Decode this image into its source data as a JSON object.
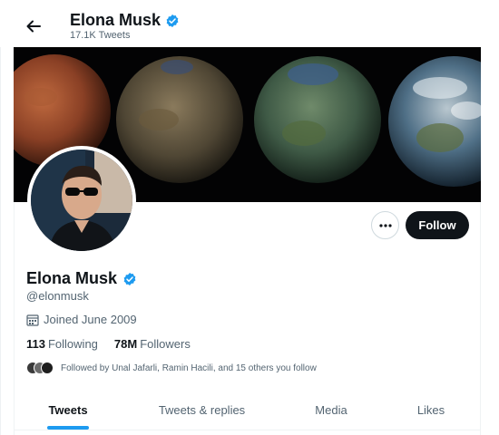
{
  "header": {
    "name": "Elona Musk",
    "tweet_count": "17.1K Tweets"
  },
  "profile": {
    "name": "Elona Musk",
    "handle": "@elonmusk",
    "joined": "Joined June 2009",
    "following_count": "113",
    "following_label": "Following",
    "followers_count": "78M",
    "followers_label": "Followers",
    "followed_by": "Followed by Unal Jafarli, Ramin Hacili, and 15 others you follow",
    "verified": true
  },
  "actions": {
    "more_icon": "ellipsis-icon",
    "follow_label": "Follow"
  },
  "banner": {
    "description_icon": "planets-banner-image"
  },
  "tabs": [
    {
      "label": "Tweets",
      "active": true
    },
    {
      "label": "Tweets & replies",
      "active": false
    },
    {
      "label": "Media",
      "active": false
    },
    {
      "label": "Likes",
      "active": false
    }
  ],
  "colors": {
    "accent": "#1d9bf0",
    "text": "#0f1419",
    "secondary": "#536471",
    "verified": "#1d9bf0"
  }
}
